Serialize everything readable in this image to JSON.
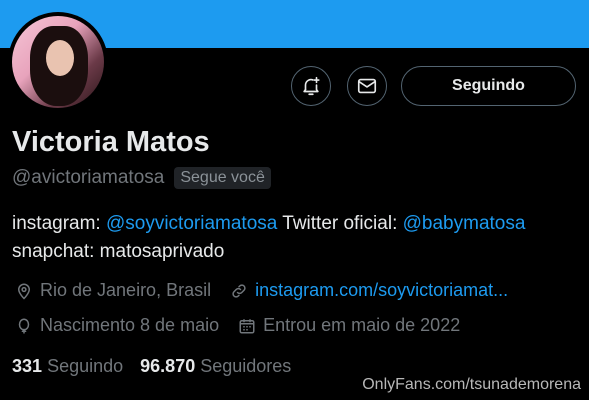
{
  "profile": {
    "name": "Victoria Matos",
    "handle": "@avictoriamatosa",
    "follows_you": "Segue você"
  },
  "actions": {
    "follow_label": "Seguindo"
  },
  "bio": {
    "p1": "instagram: ",
    "link1": "@soyvictoriamatosa",
    "p2": " Twitter oficial: ",
    "link2": "@babymatosa",
    "p3": " snapchat: matosaprivado"
  },
  "meta": {
    "location": "Rio de Janeiro, Brasil",
    "website": "instagram.com/soyvictoriamat...",
    "birthday": "Nascimento 8 de maio",
    "joined": "Entrou em maio de 2022"
  },
  "stats": {
    "following_count": "331",
    "following_label": "Seguindo",
    "followers_count": "96.870",
    "followers_label": "Seguidores"
  },
  "watermark": "OnlyFans.com/tsunademorena",
  "colors": {
    "accent": "#1d9bf0",
    "background": "#000000",
    "muted_text": "#71767b"
  }
}
